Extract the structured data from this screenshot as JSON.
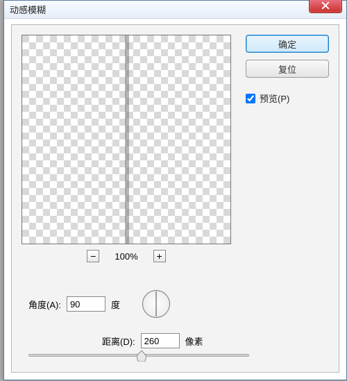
{
  "window": {
    "title": "动感模糊"
  },
  "buttons": {
    "ok": "确定",
    "reset": "复位"
  },
  "preview": {
    "checkbox_label": "预览(P)",
    "checked": true
  },
  "zoom": {
    "level": "100%",
    "minus": "−",
    "plus": "+"
  },
  "angle": {
    "label": "角度(A):",
    "value": "90",
    "unit": "度"
  },
  "distance": {
    "label": "距离(D):",
    "value": "260",
    "unit": "像素"
  },
  "icons": {
    "close": "close-icon"
  }
}
